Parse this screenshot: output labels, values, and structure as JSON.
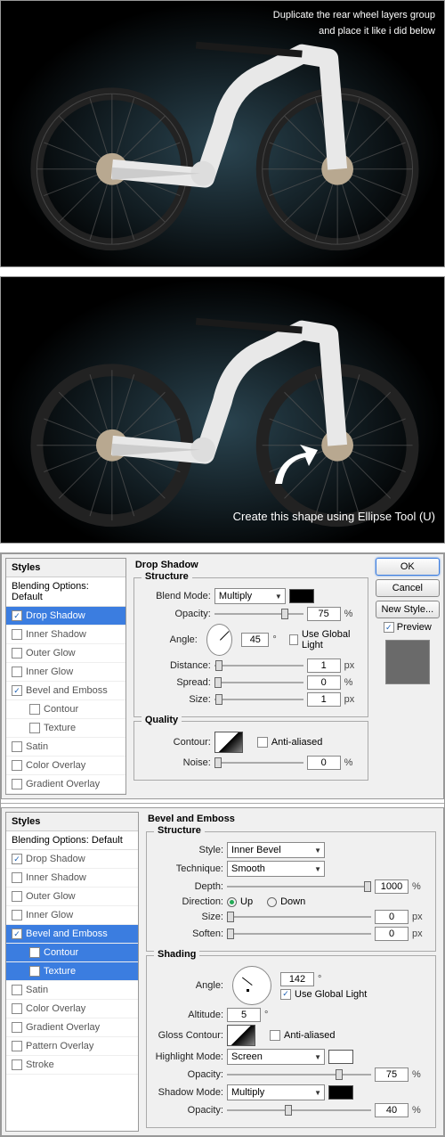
{
  "tutorial": {
    "caption1_a": "Duplicate the rear wheel layers group",
    "caption1_b": "and place it like i did below",
    "caption2": "Create this shape using Ellipse Tool (U)"
  },
  "dialog1": {
    "styles_title": "Styles",
    "blending_default": "Blending Options: Default",
    "items": [
      {
        "label": "Drop Shadow",
        "checked": true,
        "selected": true
      },
      {
        "label": "Inner Shadow",
        "checked": false
      },
      {
        "label": "Outer Glow",
        "checked": false
      },
      {
        "label": "Inner Glow",
        "checked": false
      },
      {
        "label": "Bevel and Emboss",
        "checked": true
      },
      {
        "label": "Contour",
        "checked": false,
        "sub": true
      },
      {
        "label": "Texture",
        "checked": false,
        "sub": true
      },
      {
        "label": "Satin",
        "checked": false
      },
      {
        "label": "Color Overlay",
        "checked": false
      },
      {
        "label": "Gradient Overlay",
        "checked": false
      }
    ],
    "panel_title": "Drop Shadow",
    "structure": "Structure",
    "blend_mode_lbl": "Blend Mode:",
    "blend_mode_val": "Multiply",
    "opacity_lbl": "Opacity:",
    "opacity_val": "75",
    "angle_lbl": "Angle:",
    "angle_val": "45",
    "use_global": "Use Global Light",
    "distance_lbl": "Distance:",
    "distance_val": "1",
    "spread_lbl": "Spread:",
    "spread_val": "0",
    "size_lbl": "Size:",
    "size_val": "1",
    "quality": "Quality",
    "contour_lbl": "Contour:",
    "anti_aliased": "Anti-aliased",
    "noise_lbl": "Noise:",
    "noise_val": "0",
    "px": "px",
    "pct": "%",
    "deg": "°",
    "ok": "OK",
    "cancel": "Cancel",
    "new_style": "New Style...",
    "preview": "Preview"
  },
  "dialog2": {
    "styles_title": "Styles",
    "blending_default": "Blending Options: Default",
    "items": [
      {
        "label": "Drop Shadow",
        "checked": true
      },
      {
        "label": "Inner Shadow",
        "checked": false
      },
      {
        "label": "Outer Glow",
        "checked": false
      },
      {
        "label": "Inner Glow",
        "checked": false
      },
      {
        "label": "Bevel and Emboss",
        "checked": true,
        "selected": true
      },
      {
        "label": "Contour",
        "checked": false,
        "sub": true,
        "selected": true
      },
      {
        "label": "Texture",
        "checked": false,
        "sub": true,
        "selected": true
      },
      {
        "label": "Satin",
        "checked": false
      },
      {
        "label": "Color Overlay",
        "checked": false
      },
      {
        "label": "Gradient Overlay",
        "checked": false
      },
      {
        "label": "Pattern Overlay",
        "checked": false
      },
      {
        "label": "Stroke",
        "checked": false
      }
    ],
    "panel_title": "Bevel and Emboss",
    "structure": "Structure",
    "style_lbl": "Style:",
    "style_val": "Inner Bevel",
    "technique_lbl": "Technique:",
    "technique_val": "Smooth",
    "depth_lbl": "Depth:",
    "depth_val": "1000",
    "direction_lbl": "Direction:",
    "up": "Up",
    "down": "Down",
    "size_lbl": "Size:",
    "size_val": "0",
    "soften_lbl": "Soften:",
    "soften_val": "0",
    "shading": "Shading",
    "angle_lbl": "Angle:",
    "angle_val": "142",
    "use_global": "Use Global Light",
    "altitude_lbl": "Altitude:",
    "altitude_val": "5",
    "gloss_lbl": "Gloss Contour:",
    "anti_aliased": "Anti-aliased",
    "highlight_mode_lbl": "Highlight Mode:",
    "highlight_mode_val": "Screen",
    "h_opacity_lbl": "Opacity:",
    "h_opacity_val": "75",
    "shadow_mode_lbl": "Shadow Mode:",
    "shadow_mode_val": "Multiply",
    "s_opacity_lbl": "Opacity:",
    "s_opacity_val": "40",
    "px": "px",
    "pct": "%",
    "deg": "°"
  }
}
